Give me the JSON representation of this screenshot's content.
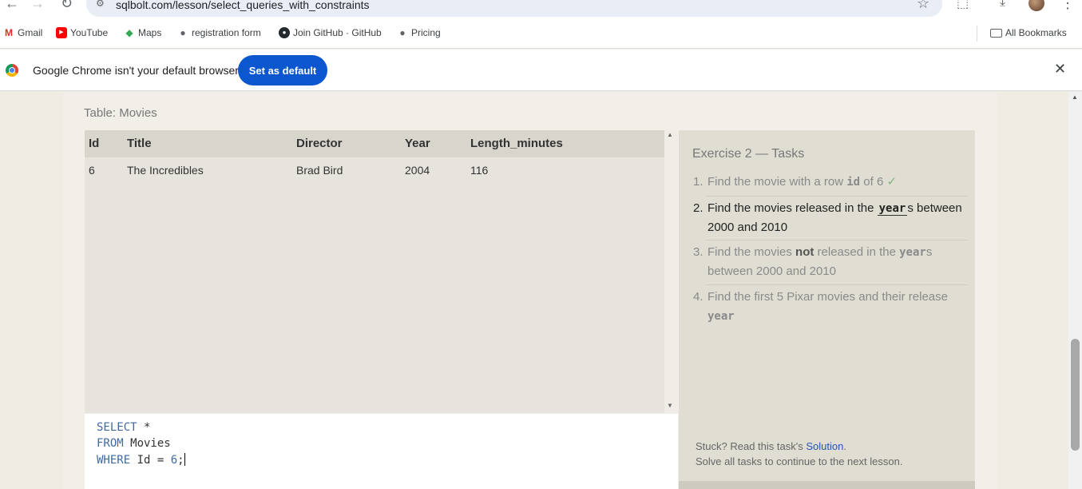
{
  "browser": {
    "url": "sqlbolt.com/lesson/select_queries_with_constraints",
    "bookmarks": [
      {
        "label": "Gmail"
      },
      {
        "label": "YouTube"
      },
      {
        "label": "Maps"
      },
      {
        "label": "registration form"
      },
      {
        "label": "Join GitHub · GitHub"
      },
      {
        "label": "Pricing"
      }
    ],
    "all_bookmarks": "All Bookmarks",
    "infobar_text": "Google Chrome isn't your default browser",
    "set_default_label": "Set as default"
  },
  "table": {
    "caption": "Table: Movies",
    "headers": [
      "Id",
      "Title",
      "Director",
      "Year",
      "Length_minutes"
    ],
    "rows": [
      [
        "6",
        "The Incredibles",
        "Brad Bird",
        "2004",
        "116"
      ]
    ]
  },
  "editor": {
    "line1_kw": "SELECT",
    "line1_rest": " *",
    "line2_kw": "FROM",
    "line2_rest": " Movies",
    "line3_kw": "WHERE",
    "line3_rest": " Id = ",
    "line3_num": "6",
    "line3_end": ";"
  },
  "tasks": {
    "title": "Exercise 2 — Tasks",
    "items": [
      {
        "num": "1.",
        "pre": "Find the movie with a row ",
        "code": "id",
        "post": " of 6 ",
        "check": "✓",
        "state": "done"
      },
      {
        "num": "2.",
        "pre": "Find the movies released in the ",
        "code": "year",
        "post": "s between 2000 and 2010",
        "state": "active"
      },
      {
        "num": "3.",
        "pre": "Find the movies ",
        "strong": "not",
        "mid": " released in the ",
        "code": "year",
        "post": "s between 2000 and 2010",
        "state": "todo"
      },
      {
        "num": "4.",
        "pre": "Find the first 5 Pixar movies and their release ",
        "code": "year",
        "state": "todo"
      }
    ],
    "stuck_pre": "Stuck? Read this task's ",
    "solution_link": "Solution",
    "stuck_post": ".",
    "continue_text": "Solve all tasks to continue to the next lesson."
  }
}
